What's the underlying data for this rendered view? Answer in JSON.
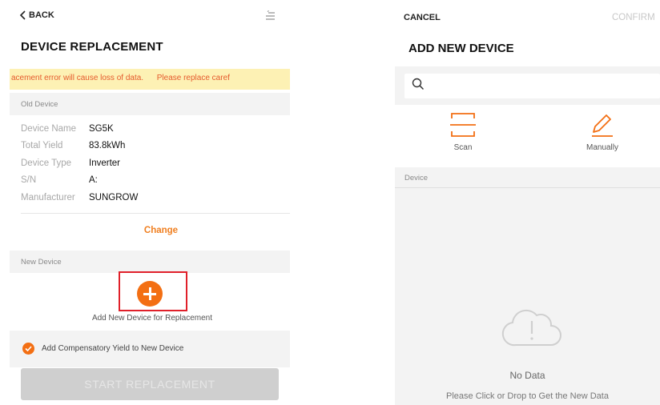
{
  "left_panel": {
    "back_label": "BACK",
    "title": "DEVICE REPLACEMENT",
    "warning": "acement error will cause loss of data.      Please replace caref",
    "old_device": {
      "header": "Old Device",
      "rows": [
        {
          "label": "Device Name",
          "value": "SG5K"
        },
        {
          "label": "Total Yield",
          "value": "83.8kWh"
        },
        {
          "label": "Device Type",
          "value": "Inverter"
        },
        {
          "label": "S/N",
          "value": "A:"
        },
        {
          "label": "Manufacturer",
          "value": "SUNGROW"
        }
      ]
    },
    "change_label": "Change",
    "new_device": {
      "header": "New Device",
      "add_caption": "Add New Device for Replacement"
    },
    "compensatory_label": "Add Compensatory Yield to New Device",
    "compensatory_checked": true,
    "start_button": "START REPLACEMENT"
  },
  "right_panel": {
    "cancel_label": "CANCEL",
    "confirm_label": "CONFIRM",
    "title": "ADD NEW DEVICE",
    "search_placeholder": "",
    "options": [
      {
        "label": "Scan",
        "icon": "scan-icon"
      },
      {
        "label": "Manually",
        "icon": "pencil-icon"
      }
    ],
    "device_header": "Device",
    "empty_title": "No Data",
    "empty_hint": "Please Click or Drop to Get the New Data"
  },
  "colors": {
    "accent": "#f36f13",
    "warning_text": "#e55a2c",
    "warning_bg": "#fdf1b4",
    "highlight_box": "#e0202a",
    "disabled_button": "#cfcfcf",
    "section_bg": "#f3f3f3"
  }
}
